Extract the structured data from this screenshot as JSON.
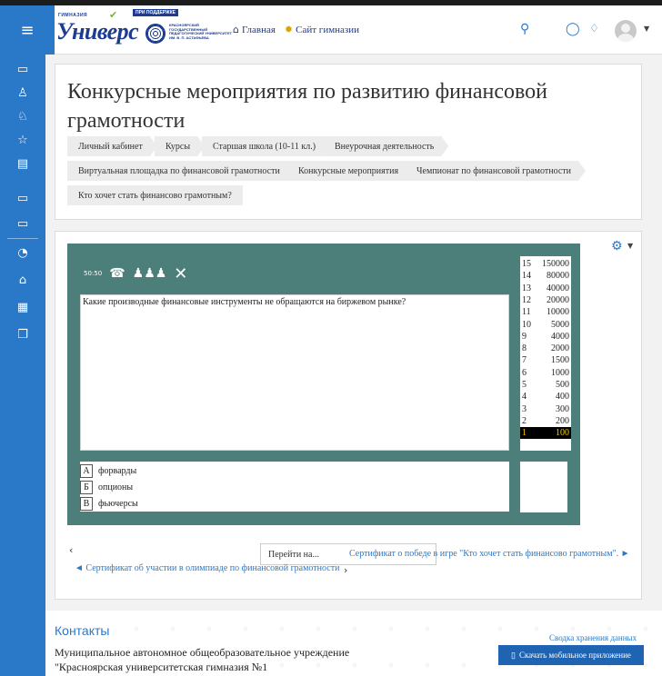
{
  "navbar": {
    "logo": {
      "gymnasium": "ГИМНАЗИЯ",
      "support": "ПРИ ПОДДЕРЖКЕ",
      "wordmark": "Универс",
      "university": "КРАСНОЯРСКИЙ ГОСУДАРСТВЕННЫЙ ПЕДАГОГИЧЕСКИЙ УНИВЕРСИТЕТ ИМ. В. П. АСТАФЬЕВА"
    },
    "links": [
      {
        "label": "Главная",
        "icon": "home-icon"
      },
      {
        "label": "Сайт гимназии",
        "icon": "gear-icon"
      }
    ],
    "icons": [
      "search-icon",
      "chat-icon",
      "bell-icon",
      "user-avatar"
    ],
    "accent": "#2a78c8"
  },
  "sidebar": {
    "items": [
      {
        "name": "folder-icon"
      },
      {
        "name": "users-icon"
      },
      {
        "name": "users-2-icon"
      },
      {
        "name": "star-icon"
      },
      {
        "name": "book-icon"
      },
      {
        "name": "folder-2-icon"
      },
      {
        "name": "folder-3-icon"
      },
      {
        "name": "dashboard-icon"
      },
      {
        "name": "home-icon"
      },
      {
        "name": "calendar-icon"
      },
      {
        "name": "copy-icon"
      }
    ]
  },
  "page": {
    "title": "Конкурсные мероприятия по развитию финансовой грамотности",
    "breadcrumbs": [
      "Личный кабинет",
      "Курсы",
      "Старшая школа (10-11 кл.)",
      "Внеурочная деятельность",
      "Виртуальная площадка по финансовой грамотности",
      "Конкурсные мероприятия",
      "Чемпионат по финансовой грамотности",
      "Кто хочет стать финансово грамотным?"
    ]
  },
  "game": {
    "timer": "50:50",
    "lifelines": [
      "phone-icon",
      "audience-icon",
      "close-icon"
    ],
    "question": "Какие производные финансовые инструменты не обращаются на биржевом рынке?",
    "answers": [
      {
        "letter": "А",
        "text": "форварды"
      },
      {
        "letter": "Б",
        "text": "опционы"
      },
      {
        "letter": "В",
        "text": "фьючерсы"
      }
    ],
    "ladder": [
      {
        "level": "15",
        "prize": "150000"
      },
      {
        "level": "14",
        "prize": "80000"
      },
      {
        "level": "13",
        "prize": "40000"
      },
      {
        "level": "12",
        "prize": "20000"
      },
      {
        "level": "11",
        "prize": "10000"
      },
      {
        "level": "10",
        "prize": "5000"
      },
      {
        "level": "9",
        "prize": "4000"
      },
      {
        "level": "8",
        "prize": "2000"
      },
      {
        "level": "7",
        "prize": "1500"
      },
      {
        "level": "6",
        "prize": "1000"
      },
      {
        "level": "5",
        "prize": "500"
      },
      {
        "level": "4",
        "prize": "400"
      },
      {
        "level": "3",
        "prize": "300"
      },
      {
        "level": "2",
        "prize": "200"
      },
      {
        "level": "1",
        "prize": "100",
        "active": true
      }
    ],
    "bg_color": "#4c7e7a"
  },
  "activity_nav": {
    "goto_label": "Перейти на...",
    "next_label": "Сертификат о победе в игре \"Кто хочет стать финансово грамотным\". ►",
    "prev_label": "◄ Сертификат об участии в олимпиаде по финансовой грамотности"
  },
  "footer": {
    "contacts_title": "Контакты",
    "organization": "Муниципальное автономное общеобразовательное учреждение \"Красноярская университетская гимназия №1",
    "retention_link": "Сводка хранения данных",
    "mobile_button": "Скачать мобильное приложение"
  }
}
